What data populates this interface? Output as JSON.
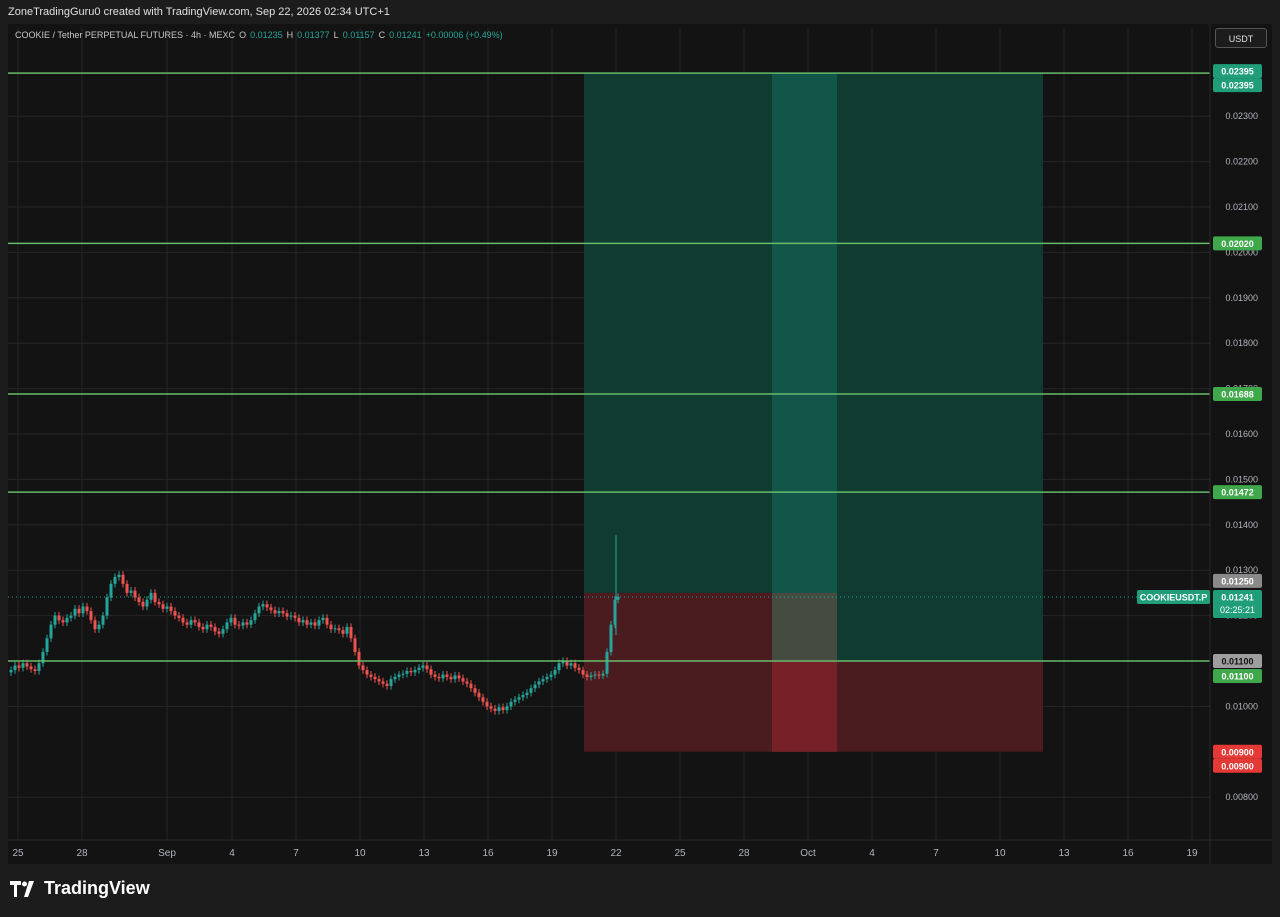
{
  "header": {
    "attribution": "ZoneTradingGuru0 created with TradingView.com, Sep 22, 2026 02:34 UTC+1"
  },
  "legend": {
    "symbol": "COOKIE / Tether PERPETUAL FUTURES · 4h · MEXC",
    "open_label": "O",
    "open": "0.01235",
    "high_label": "H",
    "high": "0.01377",
    "low_label": "L",
    "low": "0.01157",
    "close_label": "C",
    "close": "0.01241",
    "change": "+0.00006 (+0.49%)"
  },
  "currency_button": "USDT",
  "price_axis": {
    "ticks": [
      "0.02300",
      "0.02200",
      "0.02100",
      "0.02000",
      "0.01900",
      "0.01800",
      "0.01700",
      "0.01600",
      "0.01500",
      "0.01400",
      "0.01300",
      "0.01200",
      "0.01000",
      "0.00800"
    ]
  },
  "time_axis": {
    "ticks": [
      "25",
      "28",
      "Sep",
      "4",
      "7",
      "10",
      "13",
      "16",
      "19",
      "22",
      "25",
      "28",
      "Oct",
      "4",
      "7",
      "10",
      "13",
      "16",
      "19"
    ]
  },
  "levels": [
    {
      "price": "0.02395",
      "tag": "0.02395",
      "color": "#66bb6a"
    },
    {
      "price": "0.02020",
      "tag": "0.02020",
      "color": "#66bb6a"
    },
    {
      "price": "0.01688",
      "tag": "0.01688",
      "color": "#66bb6a"
    },
    {
      "price": "0.01472",
      "tag": "0.01472",
      "color": "#66bb6a"
    },
    {
      "price": "0.01100",
      "tag": "0.01100",
      "color": "#66bb6a"
    }
  ],
  "position_tags": {
    "target": "0.02395",
    "entry": "0.01250",
    "stop_a": "0.01100",
    "stop": "0.00900",
    "stop_b": "0.00900"
  },
  "last_price": {
    "symbol": "COOKIEUSDT.P",
    "price": "0.01241",
    "countdown": "02:25:21"
  },
  "colors": {
    "up": "#26a69a",
    "down": "#ef5350",
    "level": "#66bb6a",
    "profit_zone": "#0f3b30",
    "loss_zone": "#4a1b1f",
    "background": "#131313"
  },
  "brand": "TradingView"
}
